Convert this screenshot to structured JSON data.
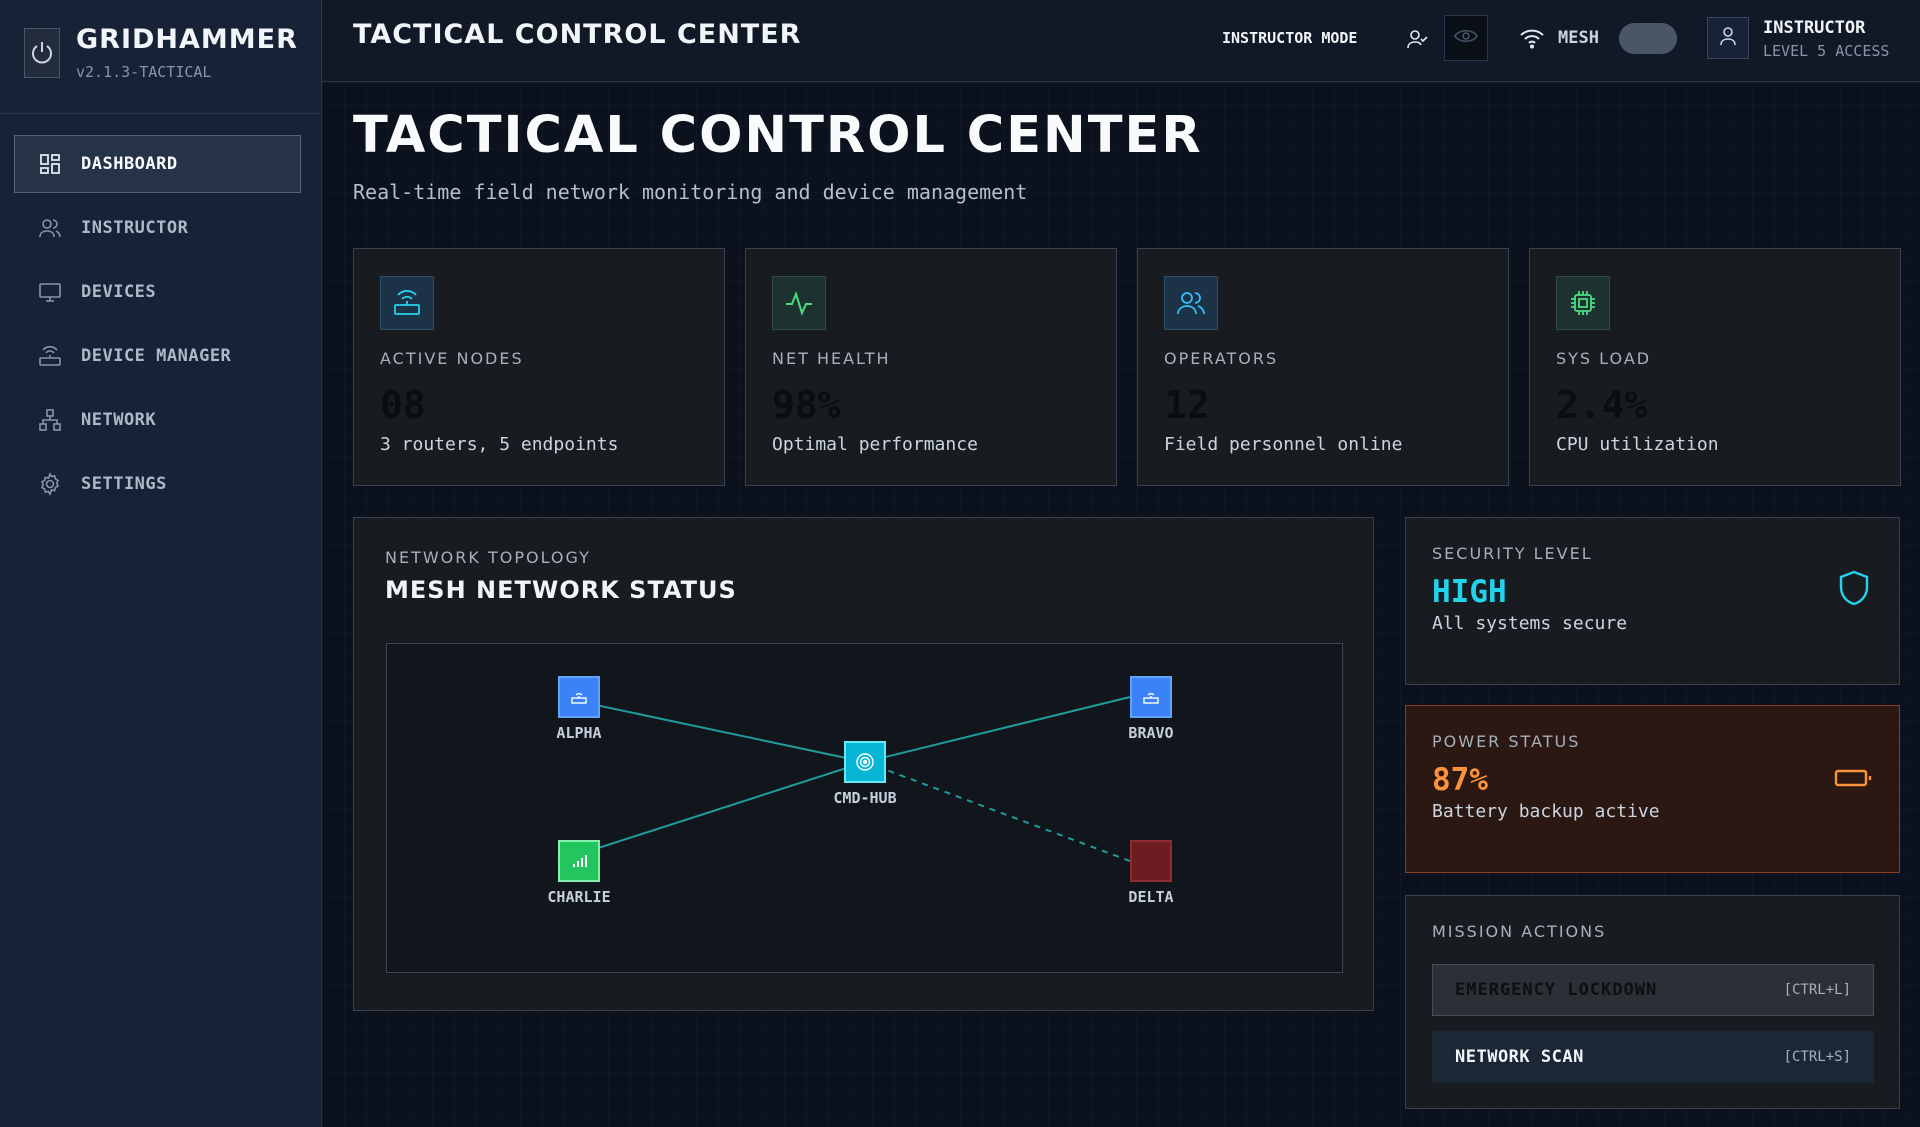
{
  "brand": {
    "name": "GRIDHAMMER",
    "version": "v2.1.3-TACTICAL",
    "icon": "power-icon"
  },
  "sidebar": {
    "items": [
      {
        "label": "DASHBOARD",
        "icon": "dashboard-grid-icon",
        "active": true
      },
      {
        "label": "INSTRUCTOR",
        "icon": "users-icon",
        "active": false
      },
      {
        "label": "DEVICES",
        "icon": "monitor-icon",
        "active": false
      },
      {
        "label": "DEVICE MANAGER",
        "icon": "router-icon",
        "active": false
      },
      {
        "label": "NETWORK",
        "icon": "network-tree-icon",
        "active": false
      },
      {
        "label": "SETTINGS",
        "icon": "gear-icon",
        "active": false
      }
    ]
  },
  "header": {
    "title": "TACTICAL CONTROL CENTER",
    "instructor_mode": "INSTRUCTOR MODE",
    "mesh_label": "MESH",
    "user_name": "INSTRUCTOR",
    "user_level": "LEVEL 5 ACCESS"
  },
  "main": {
    "title": "TACTICAL CONTROL CENTER",
    "subtitle": "Real-time field network monitoring and device management"
  },
  "stats": [
    {
      "label": "ACTIVE NODES",
      "value": "08",
      "desc": "3 routers, 5 endpoints",
      "icon": "router-icon"
    },
    {
      "label": "NET HEALTH",
      "value": "98%",
      "desc": "Optimal performance",
      "icon": "activity-icon"
    },
    {
      "label": "OPERATORS",
      "value": "12",
      "desc": "Field personnel online",
      "icon": "users-icon"
    },
    {
      "label": "SYS LOAD",
      "value": "2.4%",
      "desc": "CPU utilization",
      "icon": "cpu-icon"
    }
  ],
  "topology": {
    "kicker": "NETWORK TOPOLOGY",
    "title": "MESH NETWORK STATUS",
    "nodes": [
      {
        "label": "ALPHA",
        "type": "router",
        "color": "#3b82f6"
      },
      {
        "label": "BRAVO",
        "type": "router",
        "color": "#3b82f6"
      },
      {
        "label": "CMD-HUB",
        "type": "hub",
        "color": "#06b6d4"
      },
      {
        "label": "CHARLIE",
        "type": "endpoint",
        "color": "#22c55e"
      },
      {
        "label": "DELTA",
        "type": "offline",
        "color": "#7f1d1d"
      }
    ]
  },
  "security": {
    "kicker": "SECURITY LEVEL",
    "value": "HIGH",
    "desc": "All systems secure",
    "color": "#22d3ee"
  },
  "power": {
    "kicker": "POWER STATUS",
    "value": "87%",
    "desc": "Battery backup active",
    "color": "#fb923c"
  },
  "mission": {
    "kicker": "MISSION ACTIONS",
    "lockdown_label": "EMERGENCY LOCKDOWN",
    "lockdown_key": "[CTRL+L]",
    "scan_label": "NETWORK SCAN",
    "scan_key": "[CTRL+S]"
  },
  "colors": {
    "accent": "#22d3ee",
    "brand_bg": "#172236",
    "warning": "#fb923c"
  }
}
